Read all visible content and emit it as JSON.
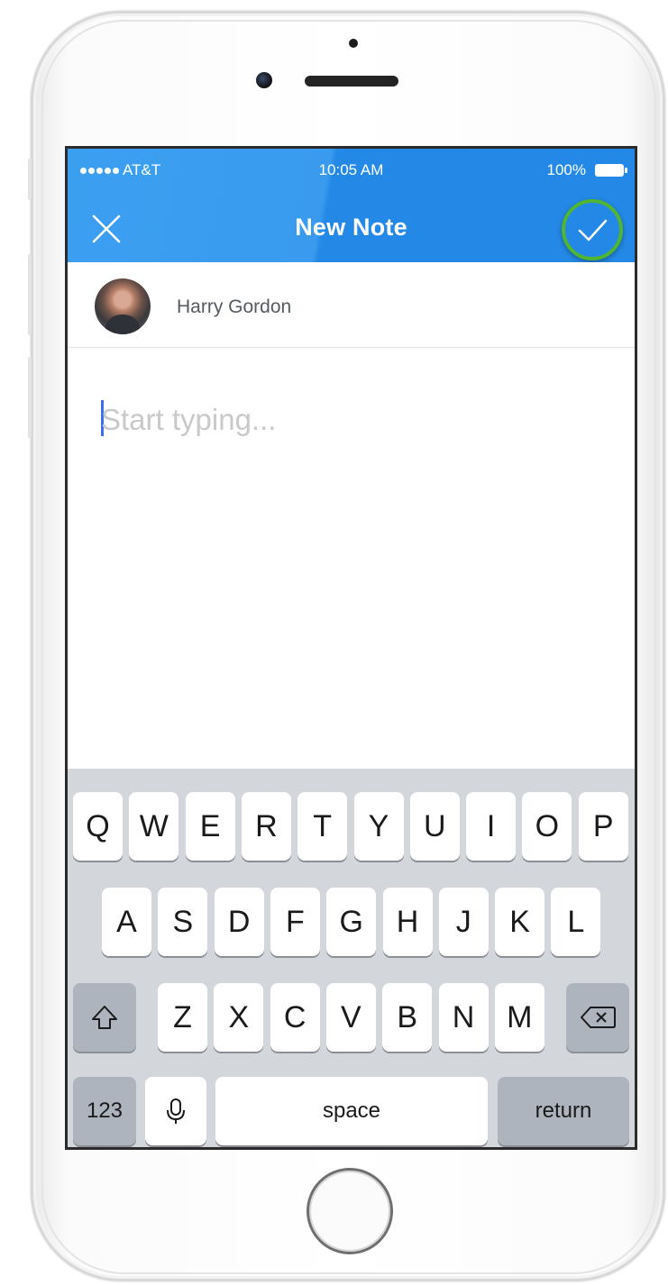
{
  "status_bar": {
    "carrier": "AT&T",
    "time": "10:05 AM",
    "battery": "100%"
  },
  "nav": {
    "title": "New Note",
    "close_icon": "close-icon",
    "save_icon": "checkmark-icon",
    "highlight_color": "#4fb532"
  },
  "author": {
    "name": "Harry Gordon"
  },
  "note": {
    "placeholder": "Start typing...",
    "value": ""
  },
  "keyboard": {
    "row1": [
      "Q",
      "W",
      "E",
      "R",
      "T",
      "Y",
      "U",
      "I",
      "O",
      "P"
    ],
    "row2": [
      "A",
      "S",
      "D",
      "F",
      "G",
      "H",
      "J",
      "K",
      "L"
    ],
    "row3": [
      "Z",
      "X",
      "C",
      "V",
      "B",
      "N",
      "M"
    ],
    "numbers_label": "123",
    "space_label": "space",
    "return_label": "return",
    "shift_icon": "shift-icon",
    "delete_icon": "backspace-icon",
    "mic_icon": "microphone-icon"
  },
  "colors": {
    "header_blue": "#2489e6",
    "keyboard_bg": "#d3d6db"
  }
}
